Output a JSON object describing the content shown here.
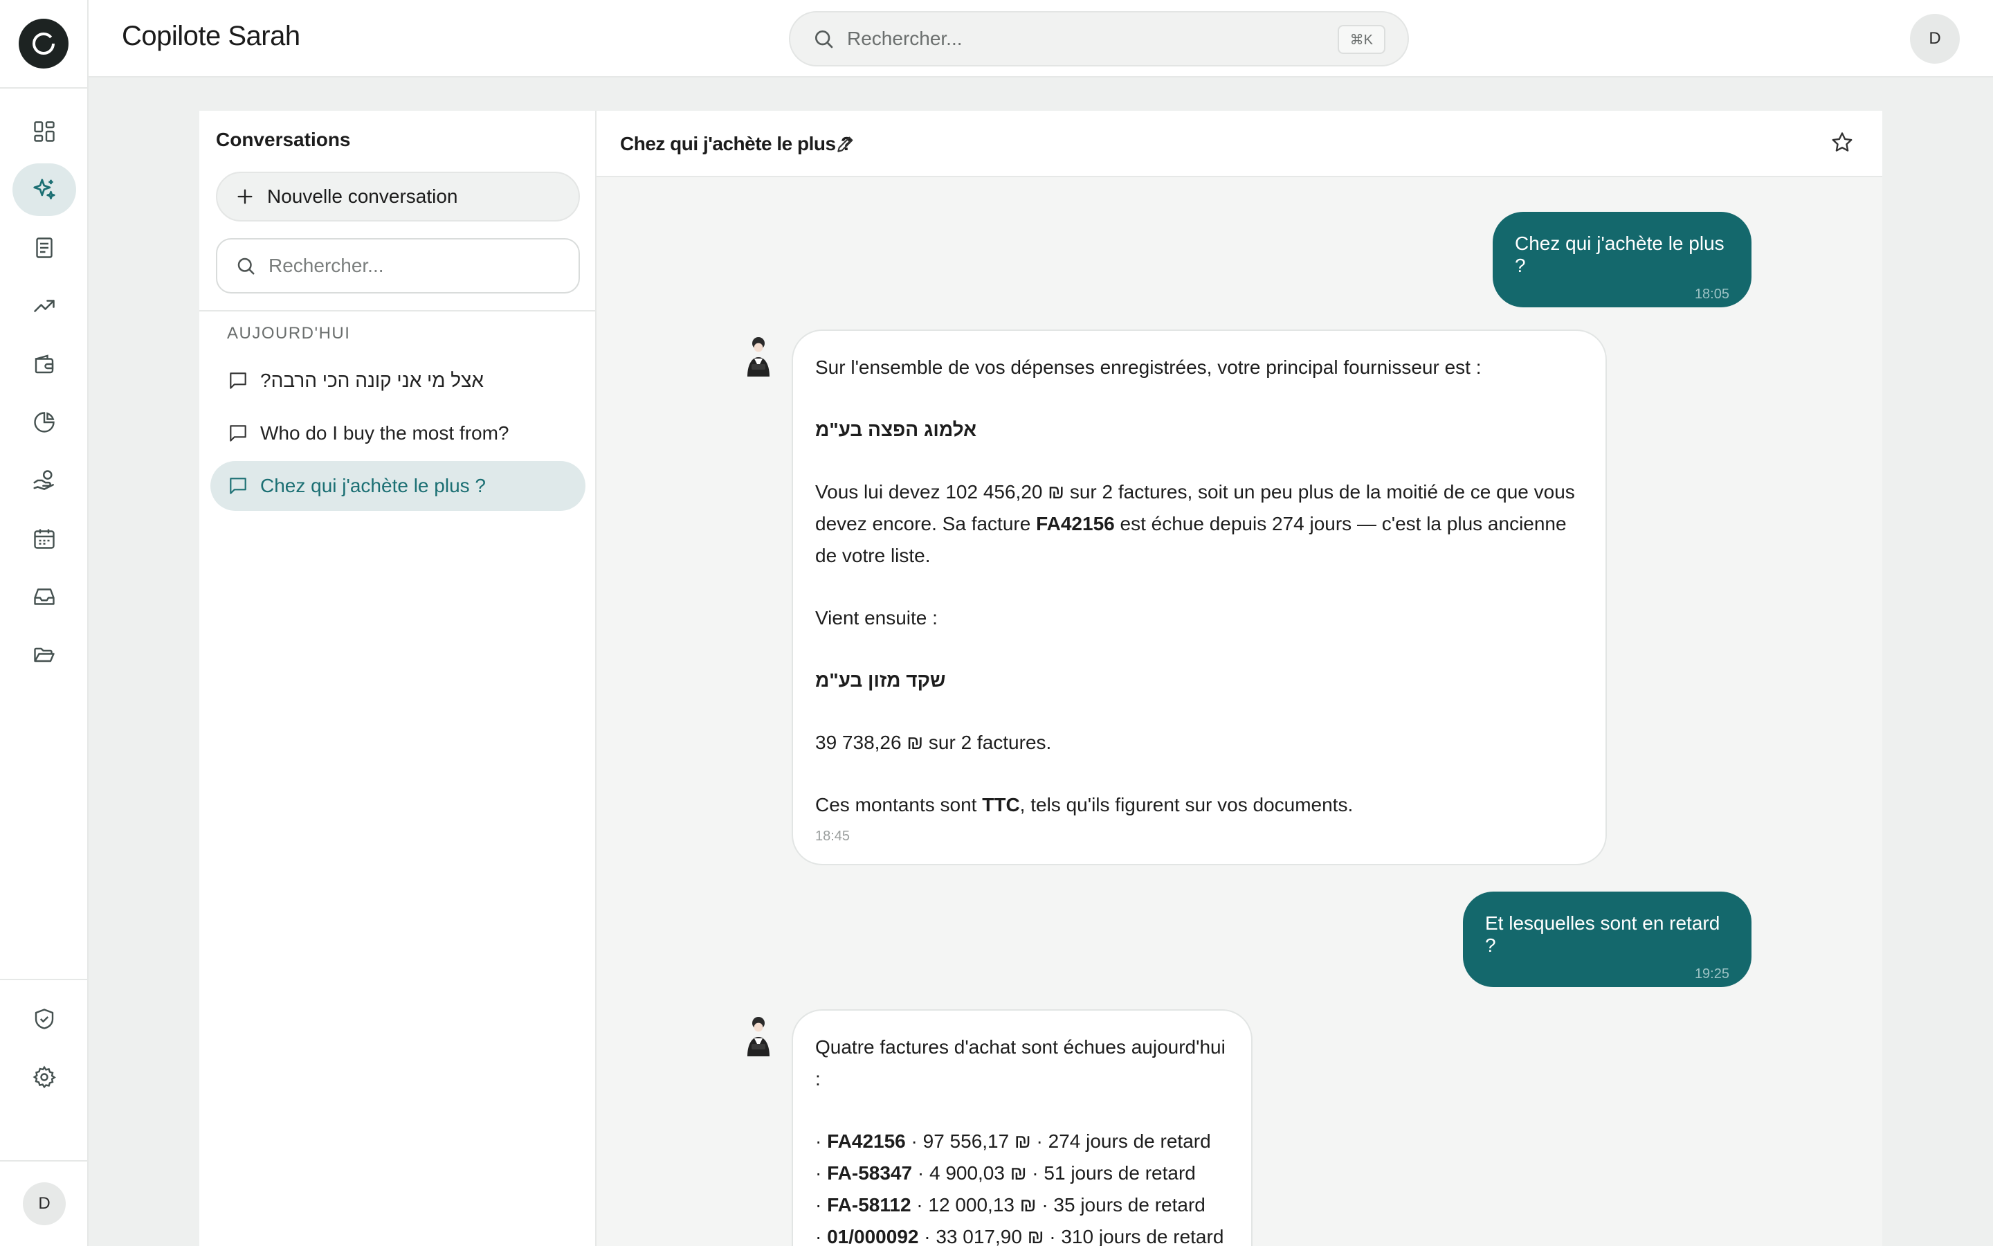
{
  "app": {
    "title": "Copilote Sarah",
    "user_initial": "D"
  },
  "search": {
    "placeholder": "Rechercher...",
    "shortcut": "⌘K"
  },
  "rail": {
    "top_items": [
      {
        "icon": "dashboard-icon",
        "active": false
      },
      {
        "icon": "sparkles-icon",
        "active": true
      },
      {
        "icon": "document-icon",
        "active": false
      },
      {
        "icon": "trending-up-icon",
        "active": false
      },
      {
        "icon": "wallet-icon",
        "active": false
      },
      {
        "icon": "pie-chart-icon",
        "active": false
      },
      {
        "icon": "hand-coins-icon",
        "active": false
      },
      {
        "icon": "calendar-icon",
        "active": false
      },
      {
        "icon": "inbox-icon",
        "active": false
      },
      {
        "icon": "folder-open-icon",
        "active": false
      }
    ],
    "bottom_items": [
      {
        "icon": "shield-check-icon"
      },
      {
        "icon": "gear-icon"
      }
    ]
  },
  "conversations": {
    "title": "Conversations",
    "new_label": "Nouvelle conversation",
    "search_placeholder": "Rechercher...",
    "section": "AUJOURD'HUI",
    "items": [
      {
        "label": "אצל מי אני קונה הכי הרבה?",
        "active": false
      },
      {
        "label": "Who do I buy the most from?",
        "active": false
      },
      {
        "label": "Chez qui j'achète le plus ?",
        "active": true
      }
    ]
  },
  "chat": {
    "title": "Chez qui j'achète le plus ?",
    "messages": {
      "m1": {
        "text": "Chez qui j'achète le plus ?",
        "time": "18:05"
      },
      "m2": {
        "intro": "Sur l'ensemble de vos dépenses enregistrées, votre principal fournisseur est :",
        "supplier1": "אלמוג הפצה בע\"מ",
        "detail1_a": "Vous lui devez 102 456,20 ₪ sur 2 factures, soit un peu plus de la moitié de ce que vous devez encore. Sa facture ",
        "detail1_b": "FA42156",
        "detail1_c": " est échue depuis 274 jours — c'est la plus ancienne de votre liste.",
        "next": "Vient ensuite :",
        "supplier2": "שקד מזון בע\"מ",
        "detail2": "39 738,26 ₪ sur 2 factures.",
        "note_a": "Ces montants sont ",
        "note_b": "TTC",
        "note_c": ", tels qu'ils figurent sur vos documents.",
        "time": "18:45"
      },
      "m3": {
        "text": "Et lesquelles sont en retard ?",
        "time": "19:25"
      },
      "m4": {
        "intro": "Quatre factures d'achat sont échues aujourd'hui :",
        "invoices": [
          {
            "id": "FA42156",
            "rest": " · 97 556,17 ₪ · 274 jours de retard"
          },
          {
            "id": "FA-58347",
            "rest": " · 4 900,03 ₪ · 51 jours de retard"
          },
          {
            "id": "FA-58112",
            "rest": " · 12 000,13 ₪ · 35 jours de retard"
          },
          {
            "id": "01/000092",
            "rest": " · 33 017,90 ₪ · 310 jours de retard"
          }
        ]
      }
    }
  }
}
